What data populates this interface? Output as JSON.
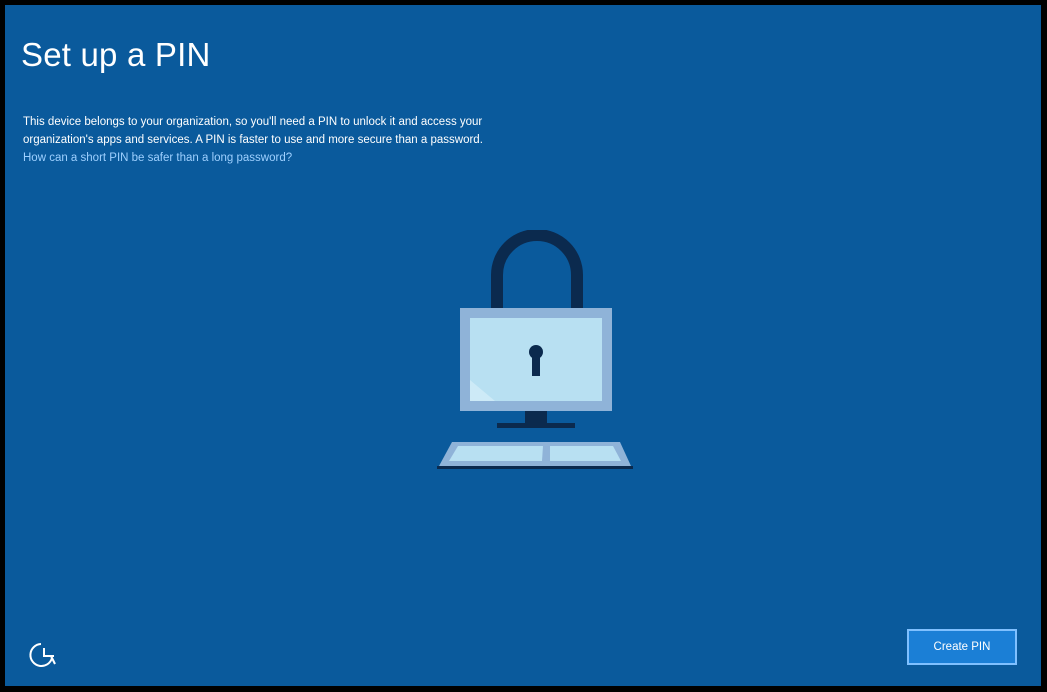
{
  "header": {
    "title": "Set up a PIN"
  },
  "description": {
    "line1": "This device belongs to your organization, so you'll need a PIN to unlock it and access your",
    "line2": "organization's apps and services. A PIN is faster to use and more secure than a password.",
    "link": "How can a short PIN be safer than a long password?"
  },
  "illustration": {
    "icon": "lock-computer-icon"
  },
  "footer": {
    "ease_of_access_icon": "ease-of-access-icon",
    "create_pin_label": "Create PIN"
  },
  "colors": {
    "background": "#0a5a9c",
    "link": "#9ed0ff",
    "button": "#1b7fd6",
    "button_border": "#7fc0ff",
    "screen_fill": "#b8e0f2",
    "frame": "#8fb3d8",
    "dark": "#0b2a4e"
  }
}
